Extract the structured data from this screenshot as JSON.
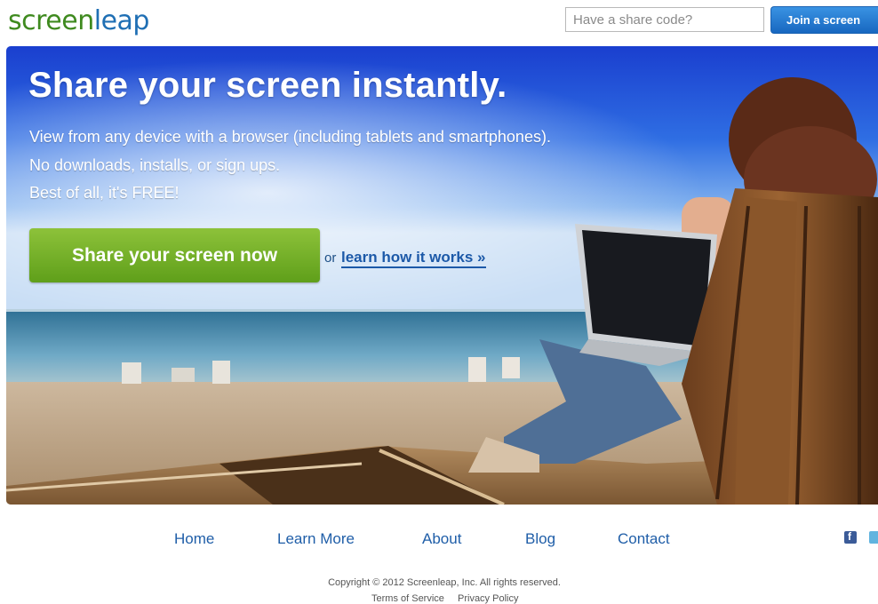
{
  "header": {
    "logo_part1": "screen",
    "logo_part2": "leap",
    "share_code_placeholder": "Have a share code?",
    "join_button": "Join a screen"
  },
  "hero": {
    "title": "Share your screen instantly.",
    "line1": "View from any device with a browser (including tablets and smartphones).",
    "line2": "No downloads, installs, or sign ups.",
    "line3": "Best of all, it's FREE!",
    "cta_button": "Share your screen now",
    "or": "or",
    "learn_link": "learn how it works »"
  },
  "footer": {
    "nav": [
      "Home",
      "Learn More",
      "About",
      "Blog",
      "Contact"
    ],
    "copyright": "Copyright © 2012 Screenleap, Inc. All rights reserved.",
    "terms": "Terms of Service",
    "privacy": "Privacy Policy",
    "social_icons": [
      "facebook-icon",
      "twitter-icon"
    ]
  },
  "colors": {
    "brand_green": "#3f8a1f",
    "brand_blue": "#1f6fb4",
    "cta_green": "#6fae22",
    "link_blue": "#1f5ea8",
    "join_blue": "#1767c0"
  }
}
